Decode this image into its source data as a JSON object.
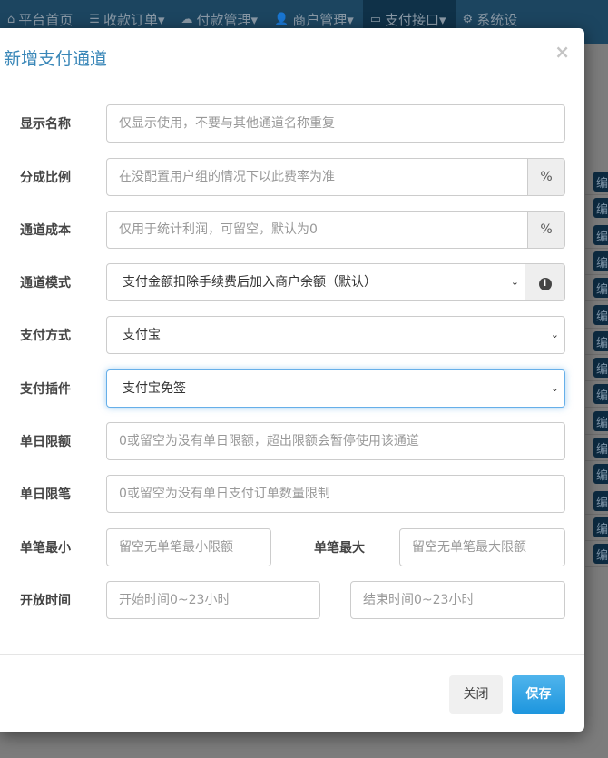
{
  "nav": [
    {
      "icon": "home-icon",
      "glyph": "⌂",
      "label": "平台首页"
    },
    {
      "icon": "list-icon",
      "glyph": "☰",
      "label": "收款订单▾"
    },
    {
      "icon": "cloud-icon",
      "glyph": "☁",
      "label": "付款管理▾"
    },
    {
      "icon": "user-icon",
      "glyph": "👤",
      "label": "商户管理▾"
    },
    {
      "icon": "card-icon",
      "glyph": "▭",
      "label": "支付接口▾"
    },
    {
      "icon": "gear-icon",
      "glyph": "⚙",
      "label": "系统设"
    }
  ],
  "background": {
    "edit_label": "编"
  },
  "modal": {
    "title": "新增支付通道",
    "close": "×",
    "fields": {
      "name": {
        "label": "显示名称",
        "placeholder": "仅显示使用，不要与其他通道名称重复"
      },
      "rate": {
        "label": "分成比例",
        "placeholder": "在没配置用户组的情况下以此费率为准",
        "addon": "%"
      },
      "cost": {
        "label": "通道成本",
        "placeholder": "仅用于统计利润，可留空，默认为0",
        "addon": "%"
      },
      "mode": {
        "label": "通道模式",
        "value": "支付金额扣除手续费后加入商户余额（默认）",
        "addon_icon": "info-icon"
      },
      "type": {
        "label": "支付方式",
        "value": "支付宝"
      },
      "plugin": {
        "label": "支付插件",
        "value": "支付宝免签"
      },
      "daylimit": {
        "label": "单日限额",
        "placeholder": "0或留空为没有单日限额，超出限额会暂停使用该通道"
      },
      "daycount": {
        "label": "单日限笔",
        "placeholder": "0或留空为没有单日支付订单数量限制"
      },
      "min": {
        "label": "单笔最小",
        "placeholder": "留空无单笔最小限额"
      },
      "max": {
        "label": "单笔最大",
        "placeholder": "留空无单笔最大限额"
      },
      "time": {
        "label": "开放时间",
        "start_placeholder": "开始时间0~23小时",
        "end_placeholder": "结束时间0~23小时"
      }
    },
    "buttons": {
      "close": "关闭",
      "save": "保存"
    }
  }
}
